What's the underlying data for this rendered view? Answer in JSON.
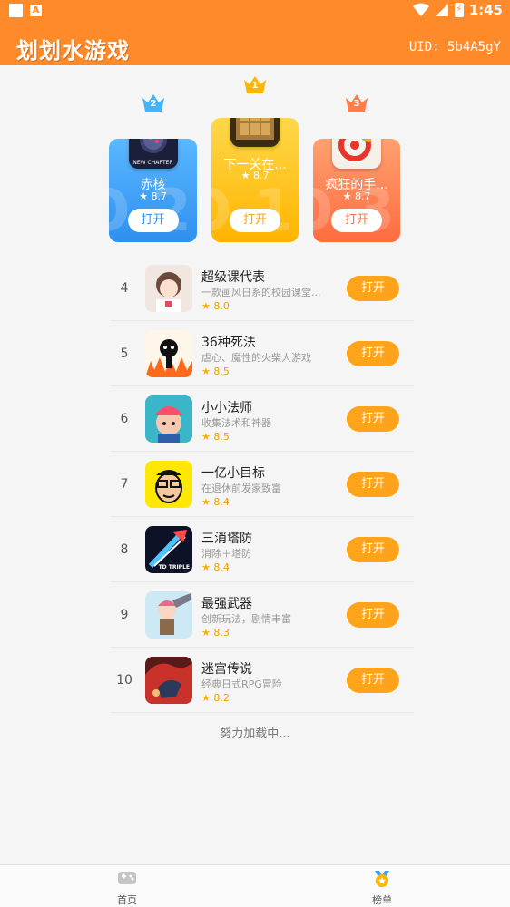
{
  "status_bar": {
    "time": "1:45"
  },
  "header": {
    "title": "划划水游戏",
    "uid": "UID: 5b4A5gY"
  },
  "colors": {
    "header_bg": "#ff8a2a",
    "open_button": "#ffa31a",
    "rank1": "#ffc21a",
    "rank2": "#3c9ff2",
    "rank3": "#ff7c4e"
  },
  "podium": [
    {
      "rank": "2",
      "name": "赤核",
      "rating": "8.7",
      "open_label": "打开",
      "icon_caption": "NEW CHAPTER",
      "watermark": "NO.2",
      "color": "#2f8ff0"
    },
    {
      "rank": "1",
      "name": "下一关在...",
      "rating": "8.7",
      "open_label": "打开",
      "watermark": "NO.1",
      "color": "#ffb400"
    },
    {
      "rank": "3",
      "name": "疯狂的手...",
      "rating": "8.7",
      "open_label": "打开",
      "watermark": "NO.3",
      "color": "#ff6c40"
    }
  ],
  "list": [
    {
      "rank": "4",
      "name": "超级课代表",
      "desc": "一款画风日系的校园课堂...",
      "rating": "8.0",
      "open_label": "打开"
    },
    {
      "rank": "5",
      "name": "36种死法",
      "desc": "虐心、魔性的火柴人游戏",
      "rating": "8.5",
      "open_label": "打开"
    },
    {
      "rank": "6",
      "name": "小小法师",
      "desc": "收集法术和神器",
      "rating": "8.5",
      "open_label": "打开"
    },
    {
      "rank": "7",
      "name": "一亿小目标",
      "desc": "在退休前发家致富",
      "rating": "8.4",
      "open_label": "打开"
    },
    {
      "rank": "8",
      "name": "三消塔防",
      "desc": "消除＋塔防",
      "rating": "8.4",
      "open_label": "打开",
      "icon_caption": "TD TRIPLE"
    },
    {
      "rank": "9",
      "name": "最强武器",
      "desc": "创新玩法，剧情丰富",
      "rating": "8.3",
      "open_label": "打开"
    },
    {
      "rank": "10",
      "name": "迷宫传说",
      "desc": "经典日式RPG冒险",
      "rating": "8.2",
      "open_label": "打开"
    }
  ],
  "loading_text": "努力加载中...",
  "bottom_nav": {
    "home_label": "首页",
    "rank_label": "榜单"
  }
}
